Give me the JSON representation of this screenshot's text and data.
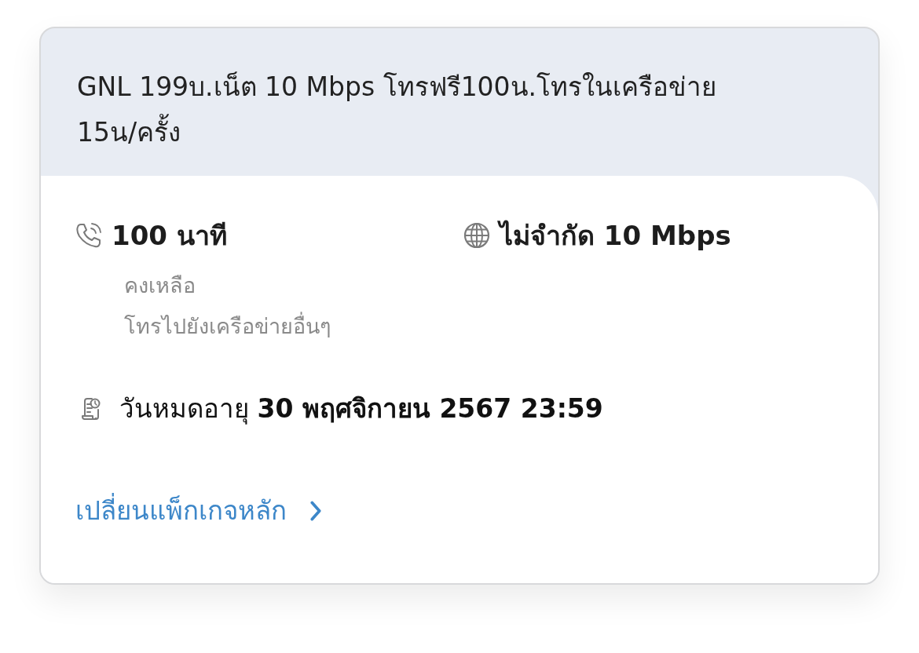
{
  "plan": {
    "title": "GNL 199บ.เน็ต 10 Mbps โทรฟรี100น.โทรในเครือข่าย 15น/ครั้ง"
  },
  "allowances": [
    {
      "kind": "call",
      "amount": "100 นาที",
      "details": [
        "คงเหลือ",
        "โทรไปยังเครือข่ายอื่นๆ"
      ]
    },
    {
      "kind": "data",
      "amount": "ไม่จำกัด 10 Mbps"
    }
  ],
  "expiry": {
    "text": "วันหมดอายุ **30 พฤศจิกายน 2567 23:59**"
  },
  "link": {
    "label": "เปลี่ยนแพ็กเกจหลัก"
  }
}
